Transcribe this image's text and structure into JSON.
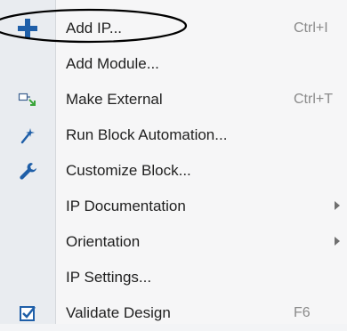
{
  "menu": {
    "items": [
      {
        "label": "Add IP...",
        "shortcut": "Ctrl+I",
        "icon": "plus-icon"
      },
      {
        "label": "Add Module...",
        "shortcut": "",
        "icon": ""
      },
      {
        "label": "Make External",
        "shortcut": "Ctrl+T",
        "icon": "make-external-icon"
      },
      {
        "label": "Run Block Automation...",
        "shortcut": "",
        "icon": "magic-wand-icon"
      },
      {
        "label": "Customize Block...",
        "shortcut": "",
        "icon": "wrench-icon"
      },
      {
        "label": "IP Documentation",
        "shortcut": "",
        "icon": "",
        "submenu": true
      },
      {
        "label": "Orientation",
        "shortcut": "",
        "icon": "",
        "submenu": true
      },
      {
        "label": "IP Settings...",
        "shortcut": "",
        "icon": ""
      },
      {
        "label": "Validate Design",
        "shortcut": "F6",
        "icon": "validate-checkbox-icon"
      }
    ],
    "colors": {
      "icon_blue": "#1f5fa8",
      "icon_green": "#3aa53a",
      "annotation": "#000000"
    }
  }
}
